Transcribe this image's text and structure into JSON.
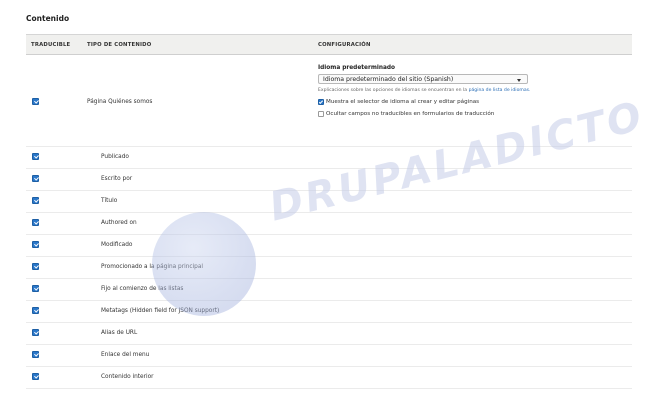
{
  "section": {
    "title": "Contenido"
  },
  "table": {
    "headers": {
      "translatable": "TRADUCIBLE",
      "content_type": "TIPO DE CONTENIDO",
      "configuration": "CONFIGURACIÓN"
    },
    "main_row": {
      "checked": true,
      "label": "Página Quiénes somos",
      "config": {
        "default_language_title": "Idioma predeterminado",
        "default_language_value": "Idioma predeterminado del sitio (Spanish)",
        "help_text": "Explicaciones sobre las opciones de idiomas se encuentran en la",
        "help_link": "página de lista de idiomas.",
        "option_show_selector": {
          "label": "Muestra el selector de idioma al crear y editar páginas",
          "checked": true
        },
        "option_hide_untranslatable": {
          "label": "Ocultar campos no traducibles en formularios de traducción",
          "checked": false
        }
      }
    },
    "field_rows": [
      {
        "label": "Publicado",
        "checked": true
      },
      {
        "label": "Escrito por",
        "checked": true
      },
      {
        "label": "Título",
        "checked": true
      },
      {
        "label": "Authored on",
        "checked": true
      },
      {
        "label": "Modificado",
        "checked": true
      },
      {
        "label": "Promocionado a la página principal",
        "checked": true
      },
      {
        "label": "Fijo al comienzo de las listas",
        "checked": true
      },
      {
        "label": "Metatags (Hidden field for JSON support)",
        "checked": true
      },
      {
        "label": "Alias de URL",
        "checked": true
      },
      {
        "label": "Enlace del menu",
        "checked": true
      },
      {
        "label": "Contenido interior",
        "checked": true
      }
    ]
  },
  "watermark": {
    "text": "DRUPALADICTO"
  },
  "colors": {
    "accent": "#2a77c9",
    "link": "#2a6db5",
    "header_bg": "#f0f0ee"
  }
}
